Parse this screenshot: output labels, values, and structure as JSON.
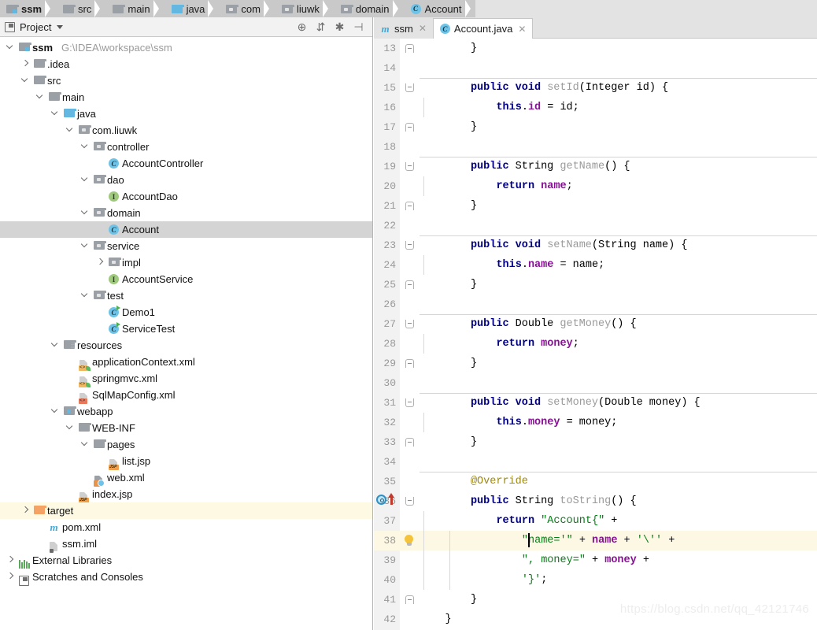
{
  "breadcrumb": {
    "items": [
      {
        "label": "ssm",
        "icon": "module-icon",
        "bold": true
      },
      {
        "label": "src",
        "icon": "folder-icon",
        "bold": false
      },
      {
        "label": "main",
        "icon": "folder-icon",
        "bold": false
      },
      {
        "label": "java",
        "icon": "source-folder-icon",
        "bold": false
      },
      {
        "label": "com",
        "icon": "package-icon",
        "bold": false
      },
      {
        "label": "liuwk",
        "icon": "package-icon",
        "bold": false
      },
      {
        "label": "domain",
        "icon": "package-icon",
        "bold": false
      },
      {
        "label": "Account",
        "icon": "java-class-icon",
        "bold": false
      }
    ]
  },
  "panel": {
    "title": "Project",
    "tools": [
      {
        "name": "locate-file-icon",
        "glyph": "⊕"
      },
      {
        "name": "collapse-all-icon",
        "glyph": "⇵"
      },
      {
        "name": "settings-gear-icon",
        "glyph": "✱"
      },
      {
        "name": "hide-panel-icon",
        "glyph": "⊣"
      }
    ],
    "tree": [
      {
        "label": "ssm",
        "sub": "G:\\IDEA\\workspace\\ssm",
        "depth": 0,
        "arrow": "down",
        "icon": "module-icon",
        "bold": true,
        "state": "normal"
      },
      {
        "label": ".idea",
        "depth": 1,
        "arrow": "right",
        "icon": "folder-icon",
        "state": "normal"
      },
      {
        "label": "src",
        "depth": 1,
        "arrow": "down",
        "icon": "folder-icon",
        "state": "normal"
      },
      {
        "label": "main",
        "depth": 2,
        "arrow": "down",
        "icon": "folder-icon",
        "state": "normal"
      },
      {
        "label": "java",
        "depth": 3,
        "arrow": "down",
        "icon": "source-folder-icon",
        "state": "normal"
      },
      {
        "label": "com.liuwk",
        "depth": 4,
        "arrow": "down",
        "icon": "package-icon",
        "state": "normal"
      },
      {
        "label": "controller",
        "depth": 5,
        "arrow": "down",
        "icon": "package-icon",
        "state": "normal"
      },
      {
        "label": "AccountController",
        "depth": 6,
        "arrow": "none",
        "icon": "java-class-icon",
        "state": "normal"
      },
      {
        "label": "dao",
        "depth": 5,
        "arrow": "down",
        "icon": "package-icon",
        "state": "normal"
      },
      {
        "label": "AccountDao",
        "depth": 6,
        "arrow": "none",
        "icon": "java-interface-icon",
        "state": "normal"
      },
      {
        "label": "domain",
        "depth": 5,
        "arrow": "down",
        "icon": "package-icon",
        "state": "normal"
      },
      {
        "label": "Account",
        "depth": 6,
        "arrow": "none",
        "icon": "java-class-icon",
        "state": "selected"
      },
      {
        "label": "service",
        "depth": 5,
        "arrow": "down",
        "icon": "package-icon",
        "state": "normal"
      },
      {
        "label": "impl",
        "depth": 6,
        "arrow": "right",
        "icon": "package-icon",
        "state": "normal"
      },
      {
        "label": "AccountService",
        "depth": 6,
        "arrow": "none",
        "icon": "java-interface-icon",
        "state": "normal"
      },
      {
        "label": "test",
        "depth": 5,
        "arrow": "down",
        "icon": "package-icon",
        "state": "normal"
      },
      {
        "label": "Demo1",
        "depth": 6,
        "arrow": "none",
        "icon": "java-test-class-icon",
        "state": "normal"
      },
      {
        "label": "ServiceTest",
        "depth": 6,
        "arrow": "none",
        "icon": "java-test-class-icon",
        "state": "normal"
      },
      {
        "label": "resources",
        "depth": 3,
        "arrow": "down",
        "icon": "resources-folder-icon",
        "state": "normal"
      },
      {
        "label": "applicationContext.xml",
        "depth": 4,
        "arrow": "none",
        "icon": "spring-xml-icon",
        "state": "normal"
      },
      {
        "label": "springmvc.xml",
        "depth": 4,
        "arrow": "none",
        "icon": "spring-xml-icon",
        "state": "normal"
      },
      {
        "label": "SqlMapConfig.xml",
        "depth": 4,
        "arrow": "none",
        "icon": "xml-icon",
        "state": "normal"
      },
      {
        "label": "webapp",
        "depth": 3,
        "arrow": "down",
        "icon": "webapp-folder-icon",
        "state": "normal"
      },
      {
        "label": "WEB-INF",
        "depth": 4,
        "arrow": "down",
        "icon": "folder-icon",
        "state": "normal"
      },
      {
        "label": "pages",
        "depth": 5,
        "arrow": "down",
        "icon": "folder-icon",
        "state": "normal"
      },
      {
        "label": "list.jsp",
        "depth": 6,
        "arrow": "none",
        "icon": "jsp-icon",
        "state": "normal"
      },
      {
        "label": "web.xml",
        "depth": 5,
        "arrow": "none",
        "icon": "web-xml-icon",
        "state": "normal"
      },
      {
        "label": "index.jsp",
        "depth": 4,
        "arrow": "none",
        "icon": "jsp-icon",
        "state": "normal"
      },
      {
        "label": "target",
        "depth": 1,
        "arrow": "right",
        "icon": "excluded-folder-icon",
        "state": "excluded"
      },
      {
        "label": "pom.xml",
        "depth": 2,
        "arrow": "none",
        "icon": "maven-icon",
        "state": "normal"
      },
      {
        "label": "ssm.iml",
        "depth": 2,
        "arrow": "none",
        "icon": "iml-icon",
        "state": "normal"
      },
      {
        "label": "External Libraries",
        "depth": 0,
        "arrow": "right",
        "icon": "libraries-icon",
        "state": "normal"
      },
      {
        "label": "Scratches and Consoles",
        "depth": 0,
        "arrow": "right",
        "icon": "scratches-icon",
        "state": "normal"
      }
    ]
  },
  "editor": {
    "tabs": [
      {
        "label": "ssm",
        "icon": "maven-icon",
        "active": false
      },
      {
        "label": "Account.java",
        "icon": "java-class-icon",
        "active": true
      }
    ],
    "lines": [
      {
        "n": 13,
        "indent": 2,
        "tokens": [
          {
            "t": "}",
            "c": "pl"
          }
        ],
        "fold": "close"
      },
      {
        "n": 14,
        "indent": 0,
        "tokens": []
      },
      {
        "n": 15,
        "indent": 2,
        "tokens": [
          {
            "t": "public",
            "c": "k"
          },
          {
            "t": " ",
            "c": "pl"
          },
          {
            "t": "void",
            "c": "k"
          },
          {
            "t": " ",
            "c": "pl"
          },
          {
            "t": "setId",
            "c": "mth"
          },
          {
            "t": "(Integer id) {",
            "c": "pl"
          }
        ],
        "fold": "open",
        "sepAbove": true
      },
      {
        "n": 16,
        "indent": 3,
        "tokens": [
          {
            "t": "this",
            "c": "k"
          },
          {
            "t": ".",
            "c": "pl"
          },
          {
            "t": "id",
            "c": "fld"
          },
          {
            "t": " = id;",
            "c": "pl"
          }
        ],
        "guide": true
      },
      {
        "n": 17,
        "indent": 2,
        "tokens": [
          {
            "t": "}",
            "c": "pl"
          }
        ],
        "fold": "close"
      },
      {
        "n": 18,
        "indent": 0,
        "tokens": []
      },
      {
        "n": 19,
        "indent": 2,
        "tokens": [
          {
            "t": "public",
            "c": "k"
          },
          {
            "t": " String ",
            "c": "pl"
          },
          {
            "t": "getName",
            "c": "mth"
          },
          {
            "t": "() {",
            "c": "pl"
          }
        ],
        "fold": "open",
        "sepAbove": true
      },
      {
        "n": 20,
        "indent": 3,
        "tokens": [
          {
            "t": "return",
            "c": "k"
          },
          {
            "t": " ",
            "c": "pl"
          },
          {
            "t": "name",
            "c": "fld"
          },
          {
            "t": ";",
            "c": "pl"
          }
        ],
        "guide": true
      },
      {
        "n": 21,
        "indent": 2,
        "tokens": [
          {
            "t": "}",
            "c": "pl"
          }
        ],
        "fold": "close"
      },
      {
        "n": 22,
        "indent": 0,
        "tokens": []
      },
      {
        "n": 23,
        "indent": 2,
        "tokens": [
          {
            "t": "public",
            "c": "k"
          },
          {
            "t": " ",
            "c": "pl"
          },
          {
            "t": "void",
            "c": "k"
          },
          {
            "t": " ",
            "c": "pl"
          },
          {
            "t": "setName",
            "c": "mth"
          },
          {
            "t": "(String name) {",
            "c": "pl"
          }
        ],
        "fold": "open",
        "sepAbove": true
      },
      {
        "n": 24,
        "indent": 3,
        "tokens": [
          {
            "t": "this",
            "c": "k"
          },
          {
            "t": ".",
            "c": "pl"
          },
          {
            "t": "name",
            "c": "fld"
          },
          {
            "t": " = name;",
            "c": "pl"
          }
        ],
        "guide": true
      },
      {
        "n": 25,
        "indent": 2,
        "tokens": [
          {
            "t": "}",
            "c": "pl"
          }
        ],
        "fold": "close"
      },
      {
        "n": 26,
        "indent": 0,
        "tokens": []
      },
      {
        "n": 27,
        "indent": 2,
        "tokens": [
          {
            "t": "public",
            "c": "k"
          },
          {
            "t": " Double ",
            "c": "pl"
          },
          {
            "t": "getMoney",
            "c": "mth"
          },
          {
            "t": "() {",
            "c": "pl"
          }
        ],
        "fold": "open",
        "sepAbove": true
      },
      {
        "n": 28,
        "indent": 3,
        "tokens": [
          {
            "t": "return",
            "c": "k"
          },
          {
            "t": " ",
            "c": "pl"
          },
          {
            "t": "money",
            "c": "fld"
          },
          {
            "t": ";",
            "c": "pl"
          }
        ],
        "guide": true
      },
      {
        "n": 29,
        "indent": 2,
        "tokens": [
          {
            "t": "}",
            "c": "pl"
          }
        ],
        "fold": "close"
      },
      {
        "n": 30,
        "indent": 0,
        "tokens": []
      },
      {
        "n": 31,
        "indent": 2,
        "tokens": [
          {
            "t": "public",
            "c": "k"
          },
          {
            "t": " ",
            "c": "pl"
          },
          {
            "t": "void",
            "c": "k"
          },
          {
            "t": " ",
            "c": "pl"
          },
          {
            "t": "setMoney",
            "c": "mth"
          },
          {
            "t": "(Double money) {",
            "c": "pl"
          }
        ],
        "fold": "open",
        "sepAbove": true
      },
      {
        "n": 32,
        "indent": 3,
        "tokens": [
          {
            "t": "this",
            "c": "k"
          },
          {
            "t": ".",
            "c": "pl"
          },
          {
            "t": "money",
            "c": "fld"
          },
          {
            "t": " = money;",
            "c": "pl"
          }
        ],
        "guide": true
      },
      {
        "n": 33,
        "indent": 2,
        "tokens": [
          {
            "t": "}",
            "c": "pl"
          }
        ],
        "fold": "close"
      },
      {
        "n": 34,
        "indent": 0,
        "tokens": []
      },
      {
        "n": 35,
        "indent": 2,
        "tokens": [
          {
            "t": "@Override",
            "c": "ann"
          }
        ],
        "sepAbove": true
      },
      {
        "n": 36,
        "indent": 2,
        "tokens": [
          {
            "t": "public",
            "c": "k"
          },
          {
            "t": " String ",
            "c": "pl"
          },
          {
            "t": "toString",
            "c": "mth"
          },
          {
            "t": "() {",
            "c": "pl"
          }
        ],
        "fold": "open",
        "marker": "override-marker"
      },
      {
        "n": 37,
        "indent": 3,
        "tokens": [
          {
            "t": "return",
            "c": "k"
          },
          {
            "t": " ",
            "c": "pl"
          },
          {
            "t": "\"Account{\"",
            "c": "str"
          },
          {
            "t": " +",
            "c": "pl"
          }
        ],
        "guide": true
      },
      {
        "n": 38,
        "indent": 4,
        "tokens": [
          {
            "t": "\"name='\"",
            "c": "str"
          },
          {
            "t": " + ",
            "c": "pl"
          },
          {
            "t": "name",
            "c": "fld"
          },
          {
            "t": " + ",
            "c": "pl"
          },
          {
            "t": "'\\''",
            "c": "str"
          },
          {
            "t": " +",
            "c": "pl"
          }
        ],
        "guide": true,
        "guide2": true,
        "highlight": true,
        "bulb": true,
        "caret": true
      },
      {
        "n": 39,
        "indent": 4,
        "tokens": [
          {
            "t": "\", money=\"",
            "c": "str"
          },
          {
            "t": " + ",
            "c": "pl"
          },
          {
            "t": "money",
            "c": "fld"
          },
          {
            "t": " +",
            "c": "pl"
          }
        ],
        "guide": true,
        "guide2": true
      },
      {
        "n": 40,
        "indent": 4,
        "tokens": [
          {
            "t": "'}'",
            "c": "str"
          },
          {
            "t": ";",
            "c": "pl"
          }
        ],
        "guide": true,
        "guide2": true
      },
      {
        "n": 41,
        "indent": 2,
        "tokens": [
          {
            "t": "}",
            "c": "pl"
          }
        ],
        "fold": "close"
      },
      {
        "n": 42,
        "indent": 1,
        "tokens": [
          {
            "t": "}",
            "c": "pl"
          }
        ]
      }
    ]
  },
  "watermark": "https://blog.csdn.net/qq_42121746"
}
